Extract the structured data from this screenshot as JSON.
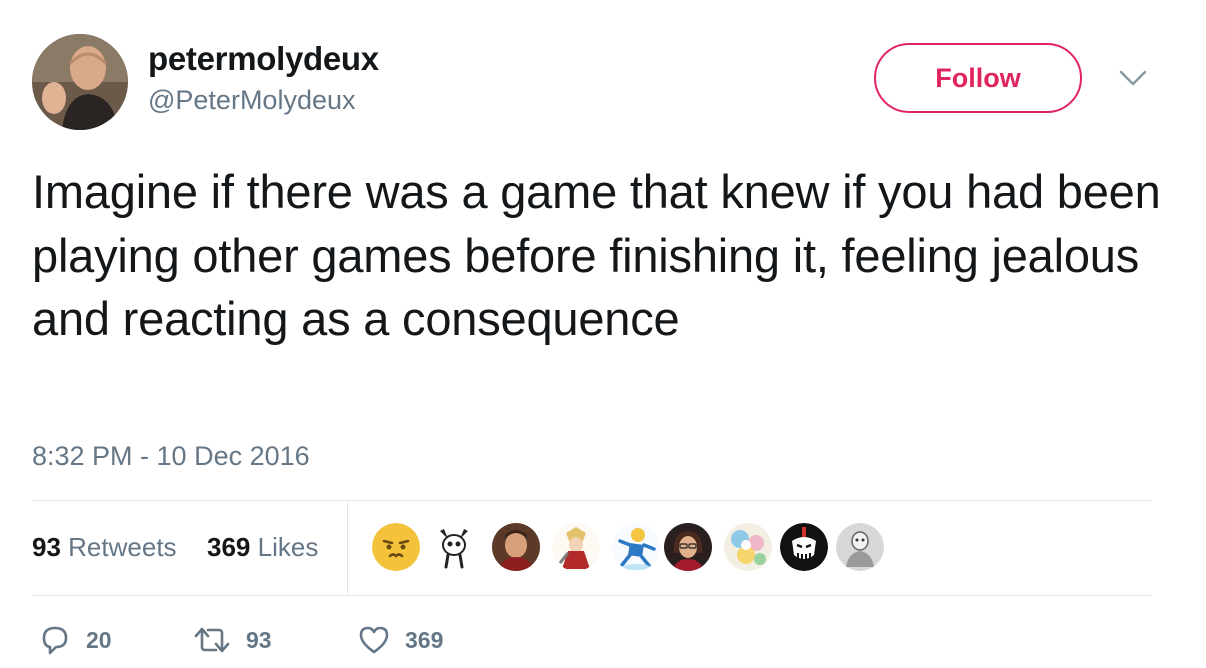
{
  "user": {
    "display_name": "petermolydeux",
    "handle": "@PeterMolydeux",
    "avatar_icon": "profile-photo"
  },
  "follow_label": "Follow",
  "menu_icon": "chevron-down-icon",
  "tweet": {
    "text": "Imagine if there was a game that knew if you had been playing other games before finishing it, feeling jealous and reacting as a consequence",
    "timestamp": "8:32 PM - 10 Dec 2016"
  },
  "stats": {
    "retweets_count": "93",
    "retweets_label": "Retweets",
    "likes_count": "369",
    "likes_label": "Likes"
  },
  "likers": [
    "emoji-face-avatar",
    "cartoon-creature-avatar",
    "man-photo-avatar",
    "anime-character-avatar",
    "cartoon-runner-avatar",
    "woman-photo-avatar",
    "colorful-art-avatar",
    "black-white-mask-avatar",
    "grey-figure-avatar"
  ],
  "actions": {
    "replies": "20",
    "retweets": "93",
    "likes": "369"
  },
  "colors": {
    "accent": "#e0245e",
    "text": "#14171a",
    "secondary": "#657786",
    "divider": "#e1e8ed"
  }
}
